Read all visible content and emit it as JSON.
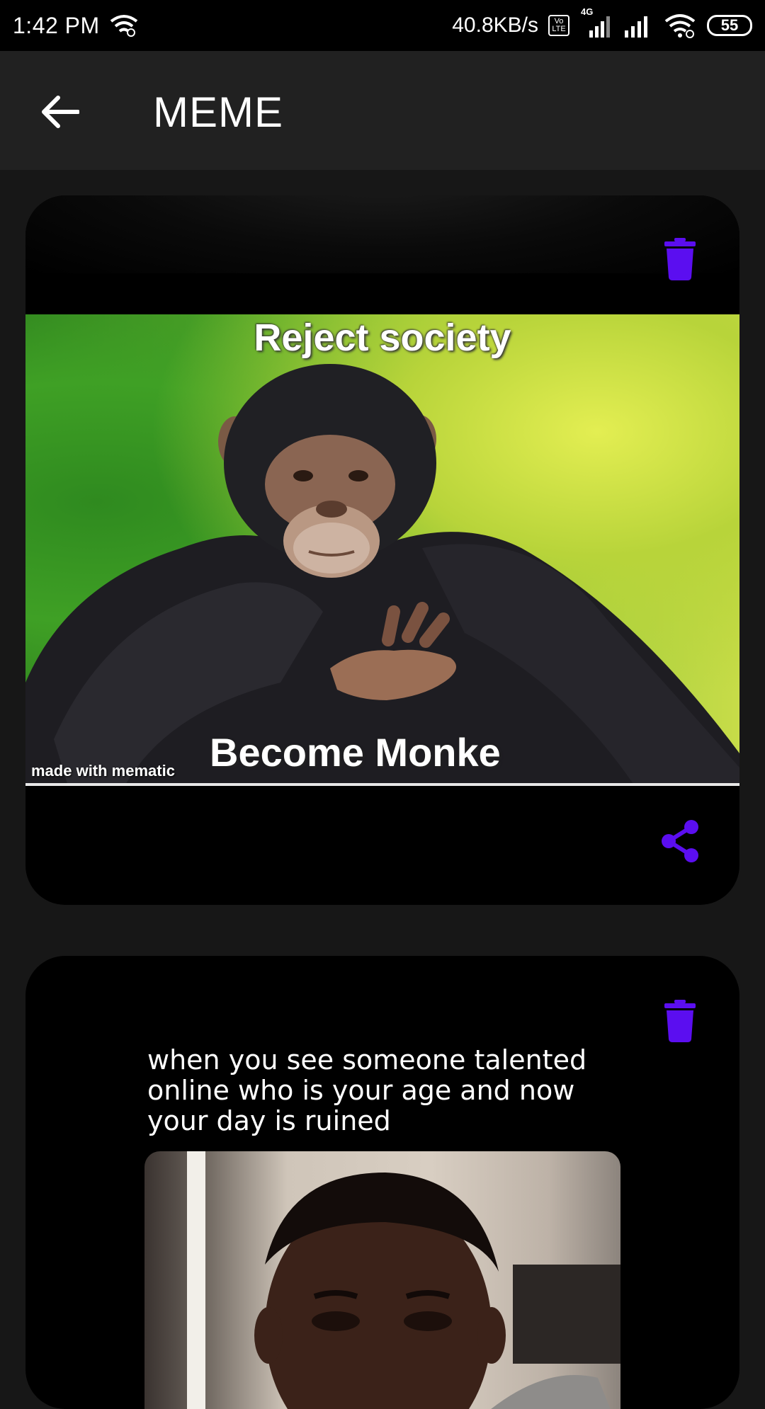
{
  "status_bar": {
    "time": "1:42 PM",
    "net_speed": "40.8KB/s",
    "volte_label": "Vo LTE",
    "network_type": "4G",
    "battery": "55"
  },
  "app_bar": {
    "title": "MEME"
  },
  "memes": [
    {
      "top_text": "Reject society",
      "bottom_text": "Become Monke",
      "watermark": "made with mematic"
    },
    {
      "caption": "when you see someone talented online who is your age and now your day is ruined"
    }
  ],
  "colors": {
    "accent": "#5b0ef0",
    "background": "#171717",
    "app_bar": "#212121",
    "card": "#000000"
  },
  "icons": {
    "back": "arrow-left-icon",
    "delete": "trash-icon",
    "share": "share-icon"
  }
}
